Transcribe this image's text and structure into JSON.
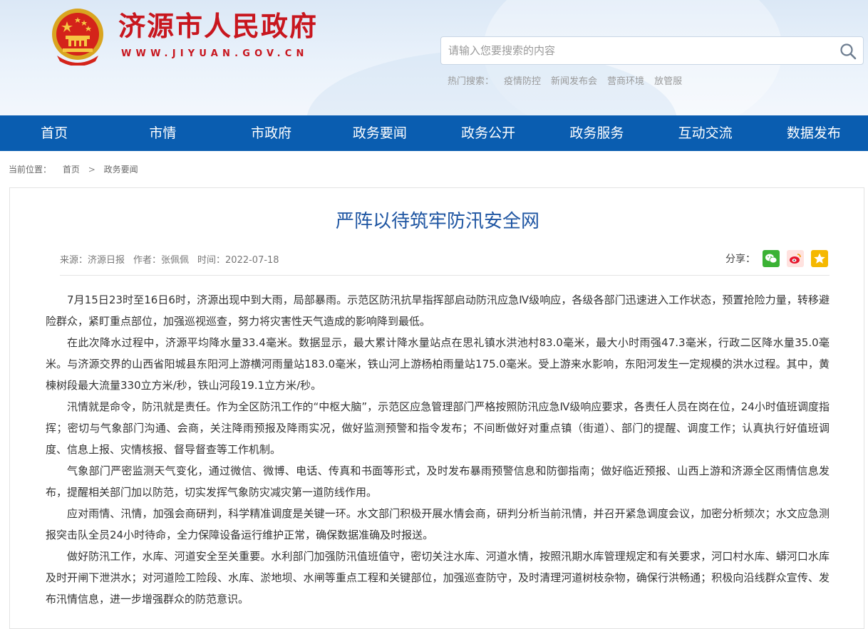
{
  "header": {
    "site_title": "济源市人民政府",
    "site_url": "WWW.JIYUAN.GOV.CN",
    "search_placeholder": "请输入您要搜索的内容",
    "hot_label": "热门搜索：",
    "hot_links": [
      "疫情防控",
      "新闻发布会",
      "营商环境",
      "放管服"
    ]
  },
  "nav": [
    "首页",
    "市情",
    "市政府",
    "政务要闻",
    "政务公开",
    "政务服务",
    "互动交流",
    "数据发布"
  ],
  "breadcrumb": {
    "label": "当前位置：",
    "items": [
      "首页",
      "政务要闻"
    ],
    "separator": ">"
  },
  "article": {
    "title": "严阵以待筑牢防汛安全网",
    "source": "来源：济源日报",
    "author": "作者：张佩佩",
    "time": "时间：2022-07-18",
    "share_label": "分享：",
    "paragraphs": [
      "7月15日23时至16日6时，济源出现中到大雨，局部暴雨。示范区防汛抗旱指挥部启动防汛应急Ⅳ级响应，各级各部门迅速进入工作状态，预置抢险力量，转移避险群众，紧盯重点部位，加强巡视巡查，努力将灾害性天气造成的影响降到最低。",
      "在此次降水过程中，济源平均降水量33.4毫米。数据显示，最大累计降水量站点在思礼镇水洪池村83.0毫米，最大小时雨强47.3毫米，行政二区降水量35.0毫米。与济源交界的山西省阳城县东阳河上游横河雨量站183.0毫米，铁山河上游杨柏雨量站175.0毫米。受上游来水影响，东阳河发生一定规模的洪水过程。其中，黄楝树段最大流量330立方米/秒，铁山河段19.1立方米/秒。",
      "汛情就是命令，防汛就是责任。作为全区防汛工作的“中枢大脑”，示范区应急管理部门严格按照防汛应急Ⅳ级响应要求，各责任人员在岗在位，24小时值班调度指挥；密切与气象部门沟通、会商，关注降雨预报及降雨实况，做好监测预警和指令发布；不间断做好对重点镇（街道）、部门的提醒、调度工作；认真执行好值班调度、信息上报、灾情核报、督导督查等工作机制。",
      "气象部门严密监测天气变化，通过微信、微博、电话、传真和书面等形式，及时发布暴雨预警信息和防御指南；做好临近预报、山西上游和济源全区雨情信息发布，提醒相关部门加以防范，切实发挥气象防灾减灾第一道防线作用。",
      "应对雨情、汛情，加强会商研判，科学精准调度是关键一环。水文部门积极开展水情会商，研判分析当前汛情，并召开紧急调度会议，加密分析频次；水文应急测报突击队全员24小时待命，全力保障设备运行维护正常，确保数据准确及时报送。",
      "做好防汛工作，水库、河道安全至关重要。水利部门加强防汛值班值守，密切关注水库、河道水情，按照汛期水库管理规定和有关要求，河口村水库、蟒河口水库及时开闸下泄洪水；对河道险工险段、水库、淤地坝、水闸等重点工程和关键部位，加强巡查防守，及时清理河道树枝杂物，确保行洪畅通；积极向沿线群众宣传、发布汛情信息，进一步增强群众的防范意识。"
    ]
  },
  "colors": {
    "nav_bg": "#0a5db0",
    "title_red": "#c8161e",
    "article_title": "#1e55a2",
    "wechat": "#3bb234",
    "weibo": "#e6162d",
    "qzone": "#f5b800"
  }
}
